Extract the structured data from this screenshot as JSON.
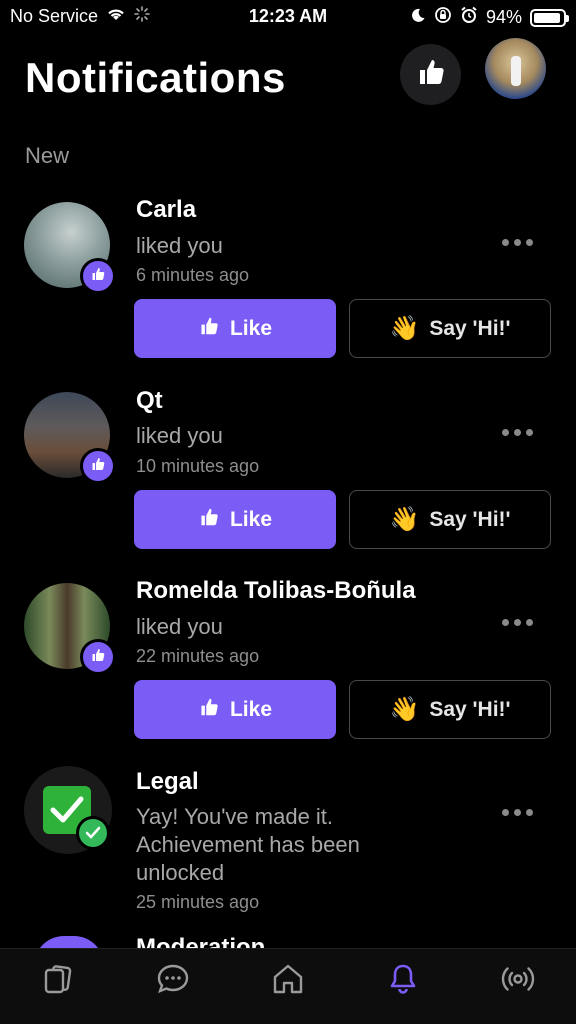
{
  "status_bar": {
    "carrier": "No Service",
    "time": "12:23 AM",
    "battery": "94%",
    "battery_level": 0.94
  },
  "header": {
    "title": "Notifications",
    "like_icon": "thumbs-up-icon",
    "avatar": "profile-avatar"
  },
  "section_label": "New",
  "notifications": [
    {
      "name": "Carla",
      "text": "liked you",
      "time": "6 minutes ago",
      "like_label": "Like",
      "hi_label": "Say 'Hi!'"
    },
    {
      "name": "Qt",
      "text": "liked you",
      "time": "10 minutes ago",
      "like_label": "Like",
      "hi_label": "Say 'Hi!'"
    },
    {
      "name": "Romelda Tolibas-Boñula",
      "text": "liked you",
      "time": "22 minutes ago",
      "like_label": "Like",
      "hi_label": "Say 'Hi!'"
    },
    {
      "name": "Legal",
      "text": "Yay! You've made it. Achievement has been unlocked",
      "time": "25 minutes ago"
    }
  ],
  "partial_item_name": "Moderation",
  "bottom_nav": [
    {
      "name": "cards-icon",
      "active": false
    },
    {
      "name": "chat-icon",
      "active": false
    },
    {
      "name": "home-icon",
      "active": false
    },
    {
      "name": "bell-icon",
      "active": true
    },
    {
      "name": "live-icon",
      "active": false
    }
  ],
  "colors": {
    "accent": "#7b5cf5",
    "background": "#000000",
    "muted_text": "#a8a8a8"
  }
}
